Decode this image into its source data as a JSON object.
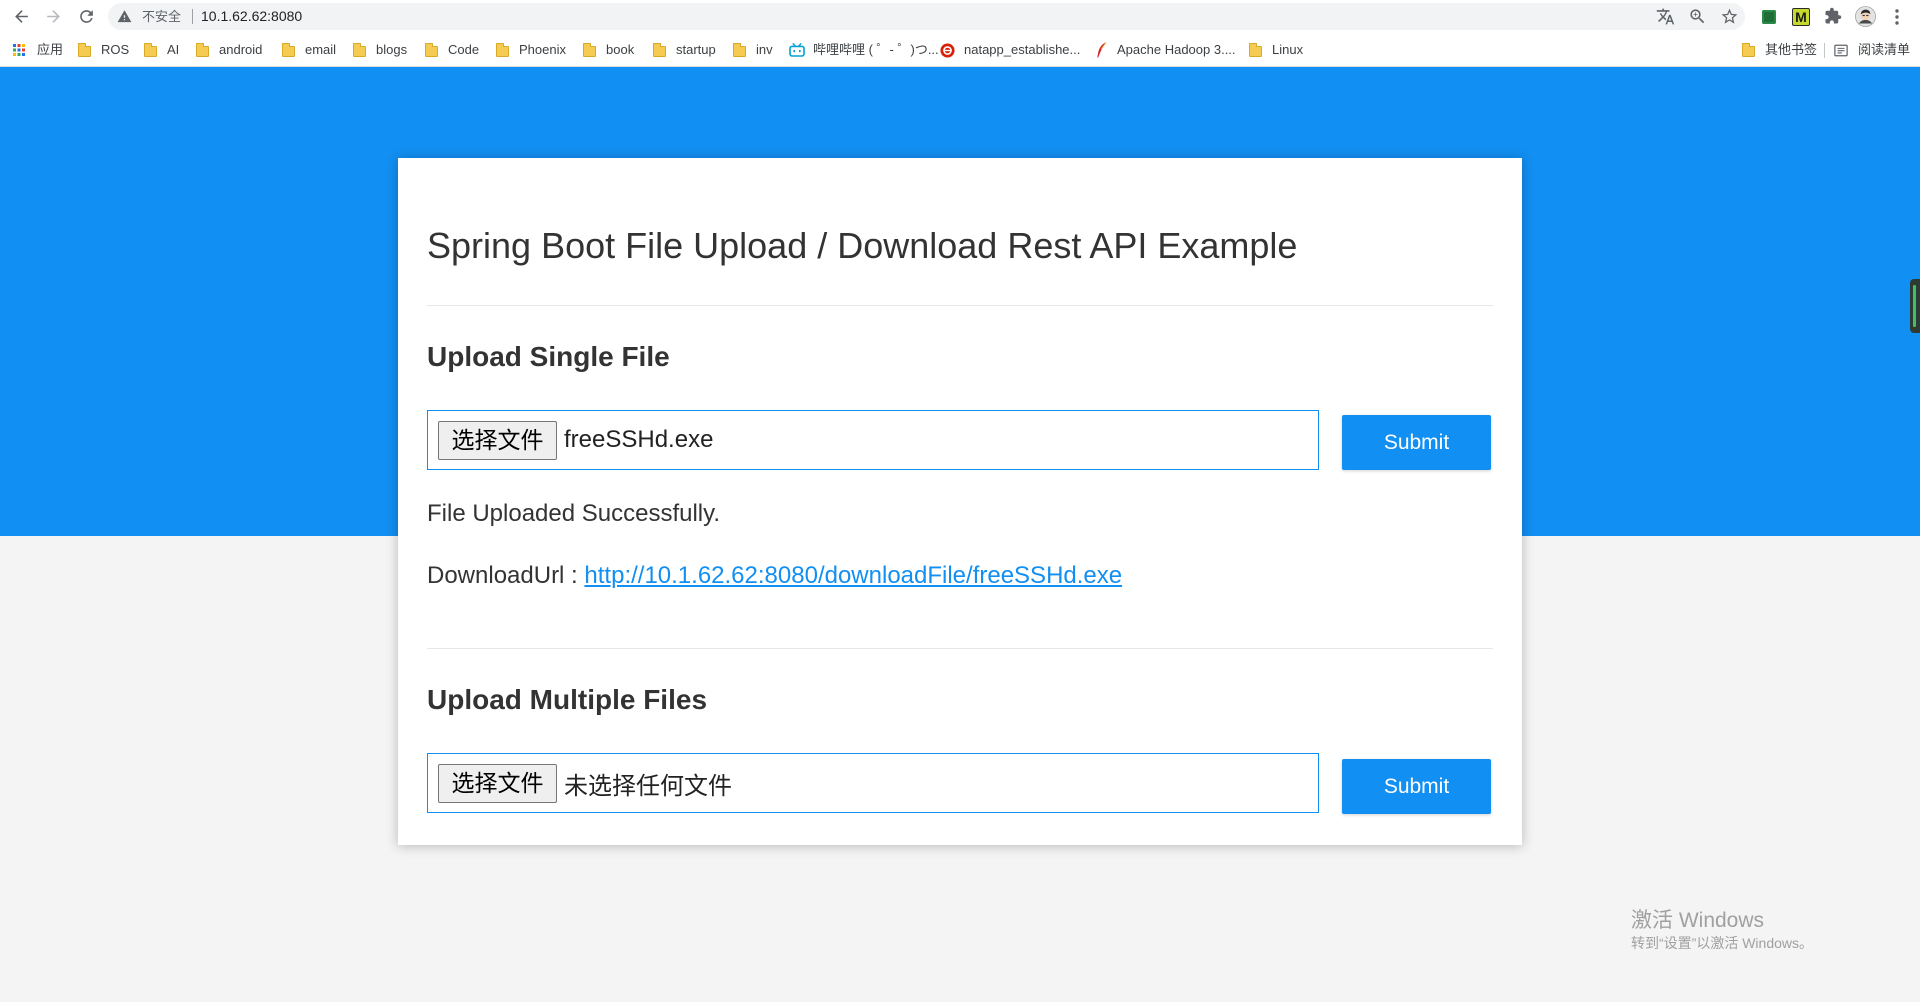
{
  "browser": {
    "nav": {
      "back_icon": "back-arrow-icon",
      "forward_icon": "forward-arrow-icon",
      "reload_icon": "reload-icon"
    },
    "address_bar": {
      "security_icon": "warning-triangle-icon",
      "security_label": "不安全",
      "url": "10.1.62.62:8080",
      "actions": [
        "translate-icon",
        "zoom-icon",
        "bookmark-star-icon"
      ]
    },
    "extensions": [
      {
        "icon": "green-square-extension-icon"
      },
      {
        "icon": "m-extension-icon",
        "glyph": "M"
      },
      {
        "icon": "puzzle-icon"
      },
      {
        "icon": "profile-avatar-icon"
      },
      {
        "icon": "menu-dots-icon"
      }
    ]
  },
  "bookmarks": {
    "items": [
      {
        "label": "应用",
        "icon": "apps-grid-icon"
      },
      {
        "label": "ROS",
        "icon": "folder-icon"
      },
      {
        "label": "AI",
        "icon": "folder-icon"
      },
      {
        "label": "android",
        "icon": "folder-icon"
      },
      {
        "label": "email",
        "icon": "folder-icon"
      },
      {
        "label": "blogs",
        "icon": "folder-icon"
      },
      {
        "label": "Code",
        "icon": "folder-icon"
      },
      {
        "label": "Phoenix",
        "icon": "folder-icon"
      },
      {
        "label": "book",
        "icon": "folder-icon"
      },
      {
        "label": "startup",
        "icon": "folder-icon"
      },
      {
        "label": "inv",
        "icon": "folder-icon"
      },
      {
        "label": "哔哩哔哩 ( ゜- ゜)つ...",
        "icon": "bilibili-icon"
      },
      {
        "label": "natapp_establishe...",
        "icon": "natapp-icon"
      },
      {
        "label": "Apache Hadoop 3....",
        "icon": "apache-feather-icon"
      },
      {
        "label": "Linux",
        "icon": "folder-icon"
      }
    ],
    "other": {
      "label": "其他书签",
      "icon": "folder-icon"
    },
    "reading_list": {
      "label": "阅读清单",
      "icon": "reading-list-icon"
    }
  },
  "page": {
    "title": "Spring Boot File Upload / Download Rest API Example",
    "single_upload": {
      "heading": "Upload Single File",
      "choose_label": "选择文件",
      "file_name": "freeSSHd.exe",
      "submit_label": "Submit",
      "status": "File Uploaded Successfully.",
      "download_prefix": "DownloadUrl : ",
      "download_url": "http://10.1.62.62:8080/downloadFile/freeSSHd.exe"
    },
    "multiple_upload": {
      "heading": "Upload Multiple Files",
      "choose_label": "选择文件",
      "file_name": "未选择任何文件",
      "submit_label": "Submit"
    }
  },
  "os_watermark": {
    "title": "激活 Windows",
    "subtitle": "转到“设置”以激活 Windows。"
  },
  "colors": {
    "banner": "#128ff2",
    "page_background": "#f4f4f4",
    "card_background": "#ffffff",
    "accent": "#128ff2",
    "link": "#128ff2",
    "text": "#333333"
  }
}
